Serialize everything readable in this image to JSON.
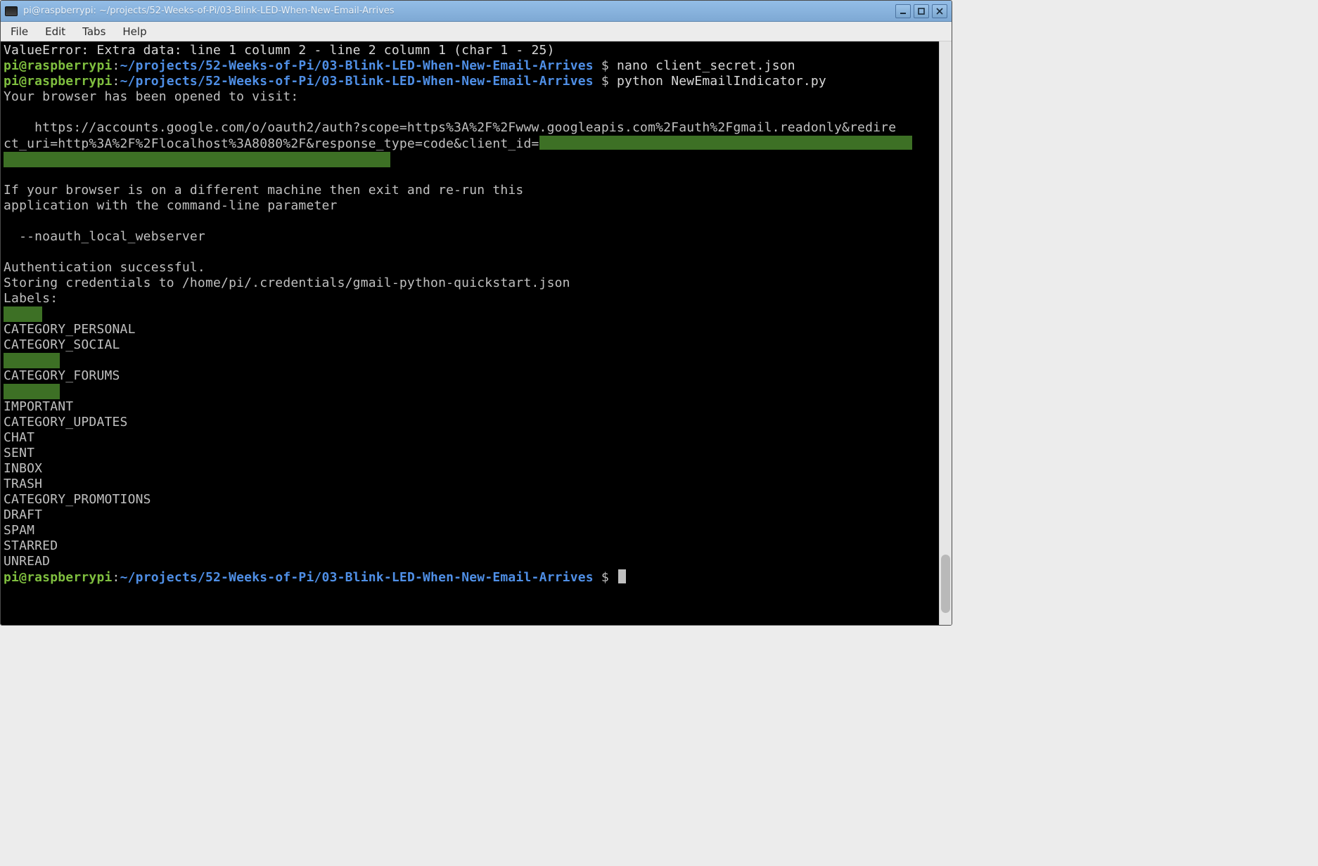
{
  "window": {
    "title": "pi@raspberrypi: ~/projects/52-Weeks-of-Pi/03-Blink-LED-When-New-Email-Arrives",
    "icon": "terminal-icon",
    "buttons": {
      "minimize": "minimize",
      "maximize": "maximize",
      "close": "close"
    }
  },
  "menubar": [
    "File",
    "Edit",
    "Tabs",
    "Help"
  ],
  "terminal": {
    "prompt": {
      "user_host": "pi@raspberrypi",
      "sep": ":",
      "cwd": "~/projects/52-Weeks-of-Pi/03-Blink-LED-When-New-Email-Arrives",
      "symbol": " $ "
    },
    "error_line": "ValueError: Extra data: line 1 column 2 - line 2 column 1 (char 1 - 25)",
    "cmd1": "nano client_secret.json",
    "cmd2": "python NewEmailIndicator.py",
    "out_browser_opened": "Your browser has been opened to visit:",
    "out_url_1": "    https://accounts.google.com/o/oauth2/auth?scope=https%3A%2F%2Fwww.googleapis.com%2Fauth%2Fgmail.readonly&redire",
    "out_url_2": "ct_uri=http%3A%2F%2Flocalhost%3A8080%2F&response_type=code&client_id=",
    "out_different_machine_1": "If your browser is on a different machine then exit and re-run this",
    "out_different_machine_2": "application with the command-line parameter",
    "out_noauth": "  --noauth_local_webserver",
    "out_auth_success": "Authentication successful.",
    "out_storing": "Storing credentials to /home/pi/.credentials/gmail-python-quickstart.json",
    "labels_header": "Labels:",
    "labels": [
      "CATEGORY_PERSONAL",
      "CATEGORY_SOCIAL",
      "CATEGORY_FORUMS",
      "IMPORTANT",
      "CATEGORY_UPDATES",
      "CHAT",
      "SENT",
      "INBOX",
      "TRASH",
      "CATEGORY_PROMOTIONS",
      "DRAFT",
      "SPAM",
      "STARRED",
      "UNREAD"
    ]
  }
}
